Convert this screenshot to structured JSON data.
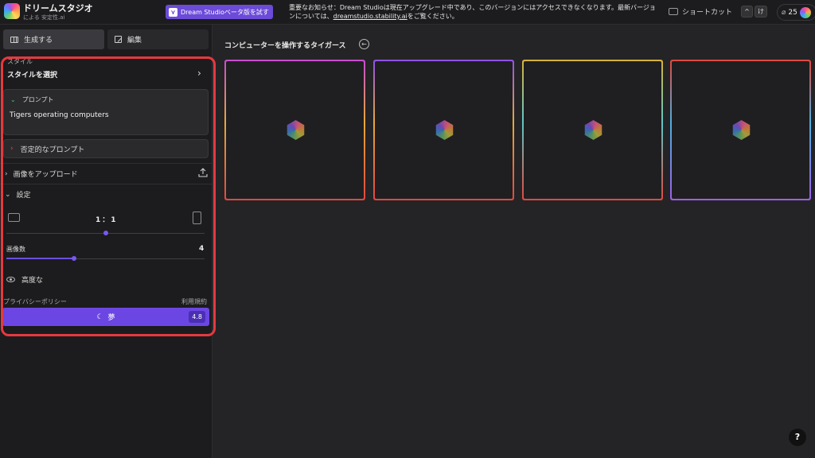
{
  "app": {
    "name": "ドリームスタジオ",
    "by": "による 安定性.ai"
  },
  "header": {
    "beta_button": "Dream Studioベータ版を試す",
    "notice_text": "重要なお知らせ：Dream Studioは現在アップグレード中であり、このバージョンにはアクセスできなくなります。最新バージョンについては、",
    "notice_link": "dreamstudio.stability.ai",
    "notice_suffix": "をご覧ください。",
    "shortcut_label": "ショートカット",
    "shortcut_key1": "^",
    "shortcut_key2": "け",
    "credits": "25"
  },
  "sidebar": {
    "tabs": [
      {
        "label": "生成する",
        "icon": "grid-icon",
        "active": true
      },
      {
        "label": "編集",
        "icon": "edit-icon",
        "active": false
      }
    ],
    "style_label": "スタイル",
    "style_select": "スタイルを選択",
    "prompt_label": "プロンプト",
    "prompt_value": "Tigers operating computers",
    "negative_prompt_label": "否定的なプロンプト",
    "upload_label": "画像をアップロード",
    "settings_label": "設定",
    "aspect_ratio": "1：1",
    "aspect_slider_fraction": 0.5,
    "image_count_label": "画像数",
    "image_count": "4",
    "image_count_fraction": 0.34,
    "advanced_label": "高度な",
    "privacy_label": "プライバシーポリシー",
    "terms_label": "利用規約",
    "dream_button": "夢",
    "dream_cost": "4.8"
  },
  "main": {
    "title": "コンピューターを操作するタイガース",
    "cards": [
      {
        "border": "linear-gradient(90deg,#e8b43e,#d8a04a,#c44d9a) , linear-gradient(#e0483f,#e0483f)",
        "c1": "#c84bd0",
        "c2": "#e8a93a",
        "c3": "#e0483f"
      },
      {
        "c1": "#8e52e6",
        "c2": "#e8a93a",
        "c3": "#e0483f"
      },
      {
        "c1": "#d9b23a",
        "c2": "#5fc7c7",
        "c3": "#e0483f"
      },
      {
        "c1": "#e0483f",
        "c2": "#4db0e0",
        "c3": "#9c5fe8"
      }
    ]
  },
  "colors": {
    "accent": "#6c46e3",
    "highlight": "#e53940"
  }
}
